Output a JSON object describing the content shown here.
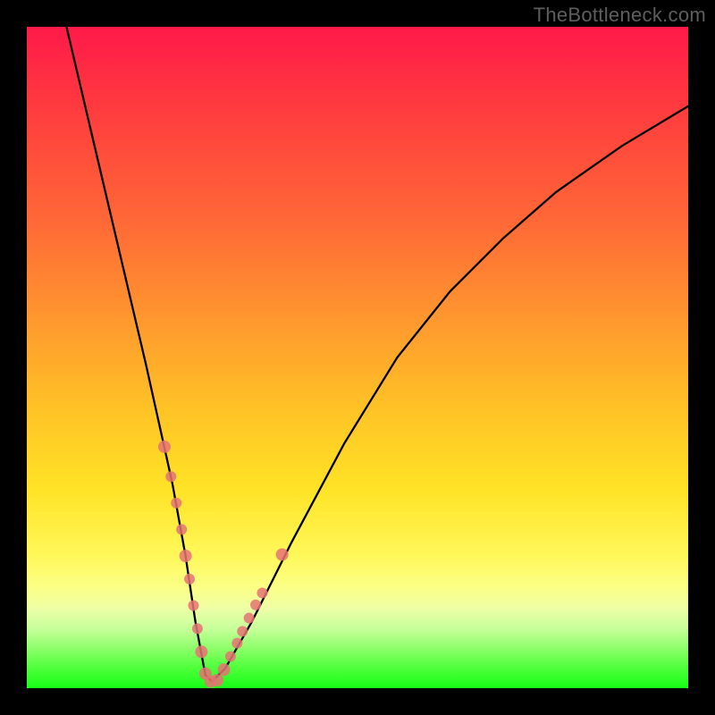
{
  "watermark": "TheBottleneck.com",
  "colors": {
    "frame_bg": "#000000",
    "gradient_top": "#ff1a49",
    "gradient_mid1": "#ff9a2e",
    "gradient_mid2": "#ffe326",
    "gradient_bottom": "#17ff17",
    "curve_stroke": "#000000",
    "marker_fill": "#e57373"
  },
  "chart_data": {
    "type": "line",
    "title": "",
    "xlabel": "",
    "ylabel": "",
    "xlim": [
      0,
      100
    ],
    "ylim": [
      0,
      100
    ],
    "grid": false,
    "series": [
      {
        "name": "bottleneck-curve",
        "x": [
          6,
          10,
          14,
          18,
          20,
          22,
          24,
          25.5,
          27,
          28,
          30,
          34,
          40,
          48,
          56,
          64,
          72,
          80,
          90,
          100
        ],
        "values": [
          100,
          83,
          66,
          49,
          40,
          31,
          20,
          10,
          2,
          1,
          3,
          10,
          22,
          37,
          50,
          60,
          68,
          75,
          82,
          88
        ]
      }
    ],
    "annotations": [],
    "markers": {
      "name": "highlighted-points",
      "x": [
        20.8,
        21.8,
        22.6,
        23.4,
        24.0,
        24.6,
        25.2,
        25.8,
        26.4,
        27.0,
        27.8,
        28.8,
        29.8,
        30.8,
        31.8,
        32.6,
        33.6,
        34.6,
        35.6,
        38.6
      ],
      "values": [
        36.5,
        32.0,
        28.0,
        24.0,
        20.0,
        16.5,
        12.5,
        9.0,
        5.5,
        2.2,
        1.0,
        1.2,
        2.8,
        4.8,
        6.8,
        8.6,
        10.6,
        12.6,
        14.4,
        20.2
      ],
      "radius": [
        7,
        6,
        6,
        6,
        7,
        6,
        6,
        6,
        7,
        7,
        7,
        7,
        7,
        6,
        6,
        6,
        6,
        6,
        6,
        7
      ]
    }
  }
}
